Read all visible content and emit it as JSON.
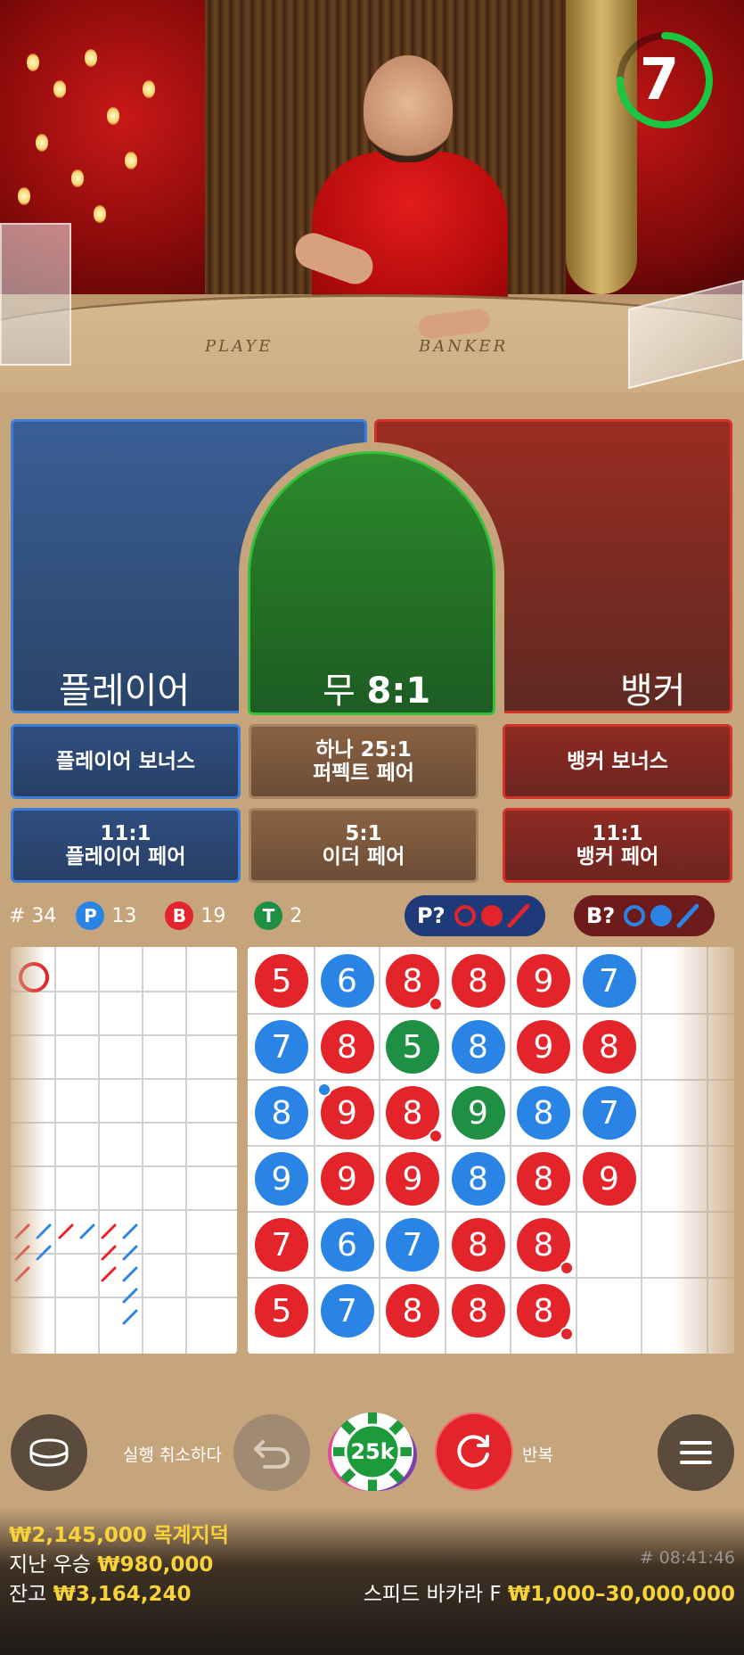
{
  "timer": {
    "seconds": "7",
    "progress": 0.75,
    "color": "#19c742"
  },
  "table_words": {
    "left": "PLAYE",
    "right": "BANKER"
  },
  "bets": {
    "player": "플레이어",
    "tie_label": "무",
    "tie_odds": "8:1",
    "banker": "뱅커"
  },
  "side_bets": {
    "player_bonus": "플레이어 보너스",
    "perfect_pair_line1": "하나 25:1",
    "perfect_pair_line2": "퍼펙트 페어",
    "banker_bonus": "뱅커 보너스",
    "player_pair_odds": "11:1",
    "player_pair": "플레이어 페어",
    "either_pair_odds": "5:1",
    "either_pair": "이더 페어",
    "banker_pair_odds": "11:1",
    "banker_pair": "뱅커 페어"
  },
  "stats": {
    "rounds": "# 34",
    "p_label": "P",
    "p_count": "13",
    "b_label": "B",
    "b_count": "19",
    "t_label": "T",
    "t_count": "2"
  },
  "predict": {
    "player": "P?",
    "banker": "B?"
  },
  "colors": {
    "player": "#2a84e6",
    "banker": "#e3242b",
    "tie": "#1f8f43"
  },
  "bead_road": [
    [
      {
        "v": "5",
        "c": "B"
      },
      {
        "v": "7",
        "c": "P"
      },
      {
        "v": "8",
        "c": "P"
      },
      {
        "v": "9",
        "c": "P"
      },
      {
        "v": "7",
        "c": "B"
      },
      {
        "v": "5",
        "c": "B"
      }
    ],
    [
      {
        "v": "6",
        "c": "P"
      },
      {
        "v": "8",
        "c": "B"
      },
      {
        "v": "9",
        "c": "B",
        "pp": true
      },
      {
        "v": "9",
        "c": "B"
      },
      {
        "v": "6",
        "c": "P"
      },
      {
        "v": "7",
        "c": "P"
      }
    ],
    [
      {
        "v": "8",
        "c": "B",
        "bp": true
      },
      {
        "v": "5",
        "c": "T"
      },
      {
        "v": "8",
        "c": "B",
        "bp": true
      },
      {
        "v": "9",
        "c": "B"
      },
      {
        "v": "7",
        "c": "P"
      },
      {
        "v": "8",
        "c": "B"
      }
    ],
    [
      {
        "v": "8",
        "c": "B"
      },
      {
        "v": "8",
        "c": "P"
      },
      {
        "v": "9",
        "c": "T"
      },
      {
        "v": "8",
        "c": "P"
      },
      {
        "v": "8",
        "c": "B"
      },
      {
        "v": "8",
        "c": "B"
      }
    ],
    [
      {
        "v": "9",
        "c": "B"
      },
      {
        "v": "9",
        "c": "B"
      },
      {
        "v": "8",
        "c": "P"
      },
      {
        "v": "8",
        "c": "B"
      },
      {
        "v": "8",
        "c": "B",
        "bp": true
      },
      {
        "v": "8",
        "c": "B",
        "bp": true
      }
    ],
    [
      {
        "v": "7",
        "c": "P"
      },
      {
        "v": "8",
        "c": "B"
      },
      {
        "v": "7",
        "c": "P"
      },
      {
        "v": "9",
        "c": "B"
      }
    ]
  ],
  "controls": {
    "undo_label": "실행 취소하다",
    "chip_value": "25k",
    "repeat_label": "반복"
  },
  "footer": {
    "bet_amount": "₩2,145,000",
    "bet_note": "목계지덕",
    "last_win_label": "지난 우승",
    "last_win_value": "₩980,000",
    "balance_label": "잔고",
    "balance_value": "₩3,164,240",
    "game_id": "# 08:41:46",
    "table_name": "스피드 바카라 F",
    "limits": "₩1,000–30,000,000"
  }
}
